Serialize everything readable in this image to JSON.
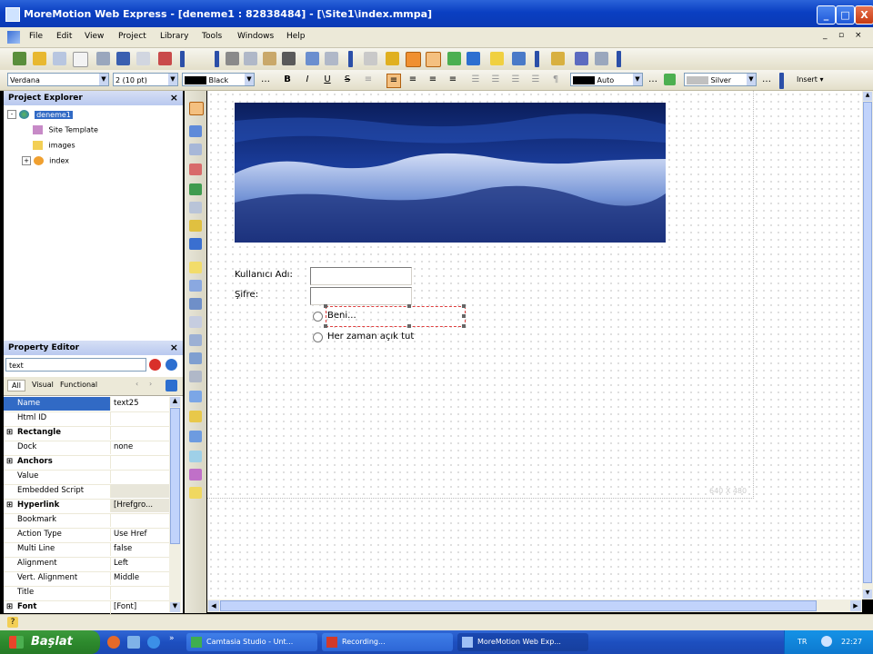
{
  "window": {
    "title": "MoreMotion Web Express - [deneme1 : 82838484] - [\\Site1\\index.mmpa]",
    "buttons": {
      "minimize": "_",
      "maximize": "□",
      "close": "X"
    }
  },
  "menu": {
    "items": [
      "File",
      "Edit",
      "View",
      "Project",
      "Library",
      "Tools",
      "Windows",
      "Help"
    ],
    "mdi_controls": [
      "_",
      "▫",
      "×"
    ]
  },
  "format_toolbar": {
    "font": "Verdana",
    "size": "2 (10 pt)",
    "text_color": "Black",
    "bold": "B",
    "italic": "I",
    "underline": "U",
    "strikethrough": "S",
    "bg_color": "Auto",
    "border_color": "Silver",
    "insert_button": "Insert"
  },
  "project_explorer": {
    "title": "Project Explorer",
    "tree": [
      {
        "label": "deneme1",
        "level": 0,
        "expander": "-"
      },
      {
        "label": "Site Template",
        "level": 1,
        "expander": ""
      },
      {
        "label": "images",
        "level": 1,
        "expander": ""
      },
      {
        "label": "index",
        "level": 1,
        "expander": "+"
      }
    ]
  },
  "property_editor": {
    "title": "Property Editor",
    "search_value": "text",
    "tabs": [
      "All",
      "Visual",
      "Functional"
    ],
    "rows": [
      {
        "name": "Name",
        "value": "text25",
        "selected": true
      },
      {
        "name": "Html ID",
        "value": ""
      },
      {
        "name": "Rectangle",
        "value": "",
        "group": true
      },
      {
        "name": "Dock",
        "value": "none"
      },
      {
        "name": "Anchors",
        "value": "",
        "group": true
      },
      {
        "name": "Value",
        "value": ""
      },
      {
        "name": "Embedded Script",
        "value": ""
      },
      {
        "name": "Hyperlink",
        "value": "[Hrefgro...",
        "group": true
      },
      {
        "name": "Bookmark",
        "value": ""
      },
      {
        "name": "Action Type",
        "value": "Use Href"
      },
      {
        "name": "Multi Line",
        "value": "false"
      },
      {
        "name": "Alignment",
        "value": "Left"
      },
      {
        "name": "Vert. Alignment",
        "value": "Middle"
      },
      {
        "name": "Title",
        "value": ""
      },
      {
        "name": "Font",
        "value": "[Font]",
        "group": true
      }
    ]
  },
  "canvas": {
    "page_size": "640 X 480",
    "form": {
      "username_label": "Kullanıcı Adı:",
      "password_label": "Şifre:",
      "radio1_label": "Beni...",
      "radio2_label": "Her zaman açık tut"
    }
  },
  "statusbar": {
    "help_icon": "?"
  },
  "taskbar": {
    "start": "Başlat",
    "tasks": [
      "Camtasia Studio - Unt...",
      "Recording...",
      "MoreMotion Web Exp..."
    ],
    "language": "TR",
    "clock": "22:27"
  }
}
